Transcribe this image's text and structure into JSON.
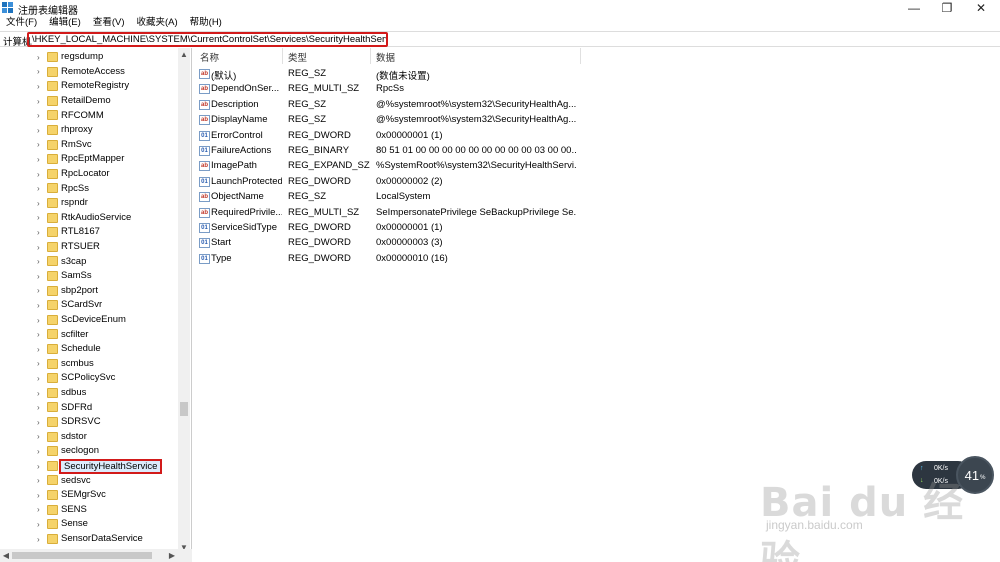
{
  "window": {
    "title": "注册表编辑器",
    "minimize_glyph": "—",
    "maximize_glyph": "❐",
    "close_glyph": "✕"
  },
  "menu": [
    "文件(F)",
    "编辑(E)",
    "查看(V)",
    "收藏夹(A)",
    "帮助(H)"
  ],
  "address": {
    "label": "计算机",
    "path": "\\HKEY_LOCAL_MACHINE\\SYSTEM\\CurrentControlSet\\Services\\SecurityHealthService"
  },
  "tree": {
    "items": [
      {
        "label": "regsdump"
      },
      {
        "label": "RemoteAccess"
      },
      {
        "label": "RemoteRegistry"
      },
      {
        "label": "RetailDemo"
      },
      {
        "label": "RFCOMM"
      },
      {
        "label": "rhproxy"
      },
      {
        "label": "RmSvc"
      },
      {
        "label": "RpcEptMapper"
      },
      {
        "label": "RpcLocator"
      },
      {
        "label": "RpcSs"
      },
      {
        "label": "rspndr"
      },
      {
        "label": "RtkAudioService"
      },
      {
        "label": "RTL8167"
      },
      {
        "label": "RTSUER"
      },
      {
        "label": "s3cap"
      },
      {
        "label": "SamSs"
      },
      {
        "label": "sbp2port"
      },
      {
        "label": "SCardSvr"
      },
      {
        "label": "ScDeviceEnum"
      },
      {
        "label": "scfilter"
      },
      {
        "label": "Schedule"
      },
      {
        "label": "scmbus"
      },
      {
        "label": "SCPolicySvc"
      },
      {
        "label": "sdbus"
      },
      {
        "label": "SDFRd"
      },
      {
        "label": "SDRSVC"
      },
      {
        "label": "sdstor"
      },
      {
        "label": "seclogon"
      },
      {
        "label": "SecurityHealthService",
        "selected": true
      },
      {
        "label": "sedsvc"
      },
      {
        "label": "SEMgrSvc"
      },
      {
        "label": "SENS"
      },
      {
        "label": "Sense"
      },
      {
        "label": "SensorDataService"
      }
    ]
  },
  "columns": {
    "name": "名称",
    "type": "类型",
    "data": "数据"
  },
  "values": [
    {
      "icon": "string-value-icon",
      "glyph": "ab",
      "name": "(默认)",
      "type": "REG_SZ",
      "data": "(数值未设置)"
    },
    {
      "icon": "string-value-icon",
      "glyph": "ab",
      "name": "DependOnSer...",
      "type": "REG_MULTI_SZ",
      "data": "RpcSs"
    },
    {
      "icon": "string-value-icon",
      "glyph": "ab",
      "name": "Description",
      "type": "REG_SZ",
      "data": "@%systemroot%\\system32\\SecurityHealthAg..."
    },
    {
      "icon": "string-value-icon",
      "glyph": "ab",
      "name": "DisplayName",
      "type": "REG_SZ",
      "data": "@%systemroot%\\system32\\SecurityHealthAg..."
    },
    {
      "icon": "binary-value-icon",
      "glyph": "01",
      "name": "ErrorControl",
      "type": "REG_DWORD",
      "data": "0x00000001 (1)"
    },
    {
      "icon": "binary-value-icon",
      "glyph": "01",
      "name": "FailureActions",
      "type": "REG_BINARY",
      "data": "80 51 01 00 00 00 00 00 00 00 00 00 03 00 00..."
    },
    {
      "icon": "string-value-icon",
      "glyph": "ab",
      "name": "ImagePath",
      "type": "REG_EXPAND_SZ",
      "data": "%SystemRoot%\\system32\\SecurityHealthServi..."
    },
    {
      "icon": "binary-value-icon",
      "glyph": "01",
      "name": "LaunchProtected",
      "type": "REG_DWORD",
      "data": "0x00000002 (2)"
    },
    {
      "icon": "string-value-icon",
      "glyph": "ab",
      "name": "ObjectName",
      "type": "REG_SZ",
      "data": "LocalSystem"
    },
    {
      "icon": "string-value-icon",
      "glyph": "ab",
      "name": "RequiredPrivile...",
      "type": "REG_MULTI_SZ",
      "data": "SeImpersonatePrivilege SeBackupPrivilege Se..."
    },
    {
      "icon": "binary-value-icon",
      "glyph": "01",
      "name": "ServiceSidType",
      "type": "REG_DWORD",
      "data": "0x00000001 (1)"
    },
    {
      "icon": "binary-value-icon",
      "glyph": "01",
      "name": "Start",
      "type": "REG_DWORD",
      "data": "0x00000003 (3)"
    },
    {
      "icon": "binary-value-icon",
      "glyph": "01",
      "name": "Type",
      "type": "REG_DWORD",
      "data": "0x00000010 (16)"
    }
  ],
  "network_widget": {
    "upload": "0K/s",
    "download": "0K/s",
    "percent": "41",
    "percent_unit": "%"
  },
  "watermark": {
    "brand": "Bai du 经验",
    "url": "jingyan.baidu.com"
  },
  "colors": {
    "highlight_border": "#d21a1a",
    "selection_bg": "#dcebfc",
    "folder": "#f5d36a"
  }
}
